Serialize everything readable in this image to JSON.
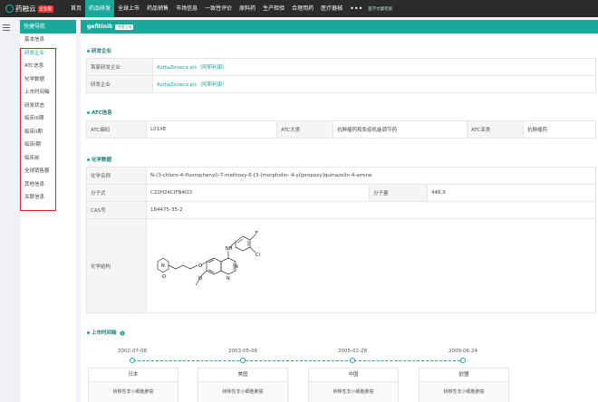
{
  "header": {
    "logo_text": "药融云",
    "logo_badge": "企业版",
    "nav": [
      "首页",
      "药品研发",
      "全球上市",
      "药品销售",
      "市场信息",
      "一致性评价",
      "原料药",
      "生产检验",
      "合理用药",
      "医疗器械"
    ],
    "nav_more": "•••",
    "nav_extra": "医学文献检索",
    "active_index": 1
  },
  "sidebar": {
    "menu_icon": "menu-icon",
    "title": "快捷导航",
    "items": [
      "基本信息",
      "研发企业",
      "ATC信息",
      "化学数据",
      "上市时间轴",
      "研发状态",
      "临床III期",
      "临床II期",
      "临床I期",
      "临床前",
      "全球销售额",
      "其他信息",
      "关联信息"
    ],
    "current_index": 1
  },
  "drug": {
    "name": "gefitinib",
    "badge": "中国上市"
  },
  "dev": {
    "title": "研发企业",
    "rows": [
      {
        "label": "首家研发企业",
        "value": "AstraZeneca plc（阿斯利康）"
      },
      {
        "label": "研发企业",
        "value": "AstraZeneca plc（阿斯利康）"
      }
    ]
  },
  "atc": {
    "title": "ATC信息",
    "code_label": "ATC编码",
    "code": "L01XE",
    "major_label": "ATC大类",
    "major": "抗肿瘤药和免疫机能调节药",
    "sub_label": "ATC亚类",
    "sub": "抗肿瘤药"
  },
  "chem": {
    "title": "化学数据",
    "name_label": "化学名称",
    "name": "N-(3-chloro-4-fluorophenyl)-7-methoxy-6-[3-(morpholin- 4-yl)propoxy]quinazolin-4-amine",
    "formula_label": "分子式",
    "formula": "C22H24ClFN4O3",
    "mw_label": "分子量",
    "mw": "446.9",
    "cas_label": "CAS号",
    "cas": "184475-35-2",
    "structure_label": "化学结构",
    "atoms": {
      "F": "F",
      "Cl": "Cl",
      "NH": "NH",
      "N1": "N",
      "N2": "N",
      "O1": "O",
      "O2": "O",
      "O3": "O",
      "N3": "N"
    }
  },
  "timeline": {
    "title": "上市时间轴",
    "info_icon": "info-icon",
    "events": [
      {
        "date": "2002-07-08",
        "country": "日本",
        "indication": "转移性非小细胞肺癌"
      },
      {
        "date": "2003-05-06",
        "country": "美国",
        "indication": "转移性非小细胞肺癌"
      },
      {
        "date": "2005-02-28",
        "country": "中国",
        "indication": "转移性非小细胞肺癌"
      },
      {
        "date": "2009-06-24",
        "country": "欧盟",
        "indication": "转移性非小细胞肺癌"
      }
    ]
  },
  "colors": {
    "brand": "#19a89a",
    "topbar": "#2b2b2b",
    "highlight_box": "#e02020"
  }
}
